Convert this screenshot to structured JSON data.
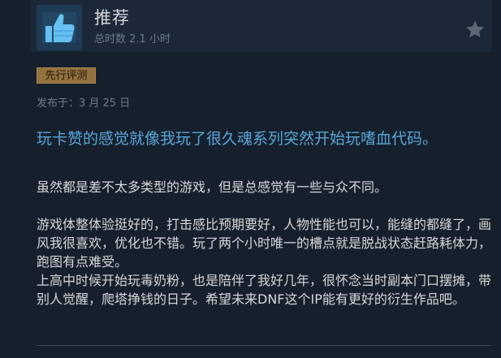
{
  "review": {
    "verdict": "推荐",
    "verdict_icon": "thumbs-up-icon",
    "hours": "总时数 2.1 小时",
    "badge": "先行评测",
    "posted": "发布于：3 月 25 日",
    "title": "玩卡赞的感觉就像我玩了很久魂系列突然开始玩嗜血代码。",
    "paragraphs": [
      "虽然都是差不太多类型的游戏，但是总感觉有一些与众不同。",
      "游戏体整体验挺好的，打击感比预期要好，人物性能也可以，能缝的都缝了，画风我很喜欢，优化也不错。玩了两个小时唯一的槽点就是脱战状态赶路耗体力，跑图有点难受。",
      "上高中时候开始玩毒奶粉，也是陪伴了我好几年，很怀念当时副本门口摆摊，带别人觉醒，爬塔挣钱的日子。希望未来DNF这个IP能有更好的衍生作品吧。"
    ]
  },
  "icons": {
    "favorite": "star-icon"
  },
  "colors": {
    "background": "#16202d",
    "header": "#1b2838",
    "thumb_bg": "#1e3a55",
    "thumb": "#66c0f4",
    "title": "#57a6d8",
    "badge": "#93713d"
  }
}
